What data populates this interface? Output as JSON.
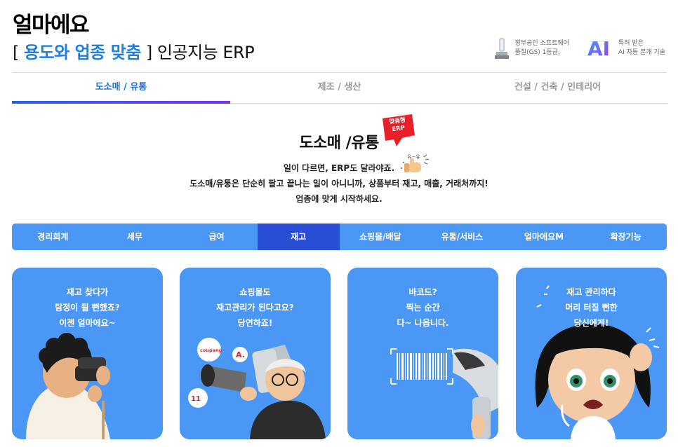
{
  "brand": {
    "logo": "얼마에요"
  },
  "tagline": {
    "open": "[ ",
    "highlight": "용도와 업종 맞춤",
    "close": " ] ",
    "rest": "인공지능 ERP"
  },
  "badges": [
    {
      "icon": "trophy-icon",
      "lines": [
        "정부공인 소프트웨어",
        "품질(GS) 1등급,"
      ]
    },
    {
      "mark": "AI",
      "lines": [
        "특허 받은",
        "AI 자동 분개 기술"
      ]
    }
  ],
  "tabs": [
    {
      "label": "도소매 / 유통",
      "active": true
    },
    {
      "label": "제조 / 생산",
      "active": false
    },
    {
      "label": "건설 / 건축 / 인테리어",
      "active": false
    }
  ],
  "section": {
    "title": "도소매 /유통",
    "ribbon": [
      "맞춤형",
      "ERP"
    ],
    "lines": [
      "일이 다르면, ERP도 달라야죠.",
      "도소매/유통은 단순히 팔고 끝나는 일이 아니니까, 상품부터 재고, 매출, 거래처까지!",
      "업종에 맞게 시작하세요."
    ]
  },
  "categories": [
    {
      "label": "경리회계",
      "active": false
    },
    {
      "label": "세무",
      "active": false
    },
    {
      "label": "급여",
      "active": false
    },
    {
      "label": "재고",
      "active": true
    },
    {
      "label": "쇼핑몰/배달",
      "active": false
    },
    {
      "label": "유통/서비스",
      "active": false
    },
    {
      "label": "얼마에요M",
      "active": false
    },
    {
      "label": "확장기능",
      "active": false
    }
  ],
  "cards": [
    {
      "lines": [
        "재고 찾다가",
        "탐정이 될 뻔했죠?",
        "이젠 얼마에요~"
      ],
      "illustration": "binoculars-person"
    },
    {
      "lines": [
        "쇼핑몰도",
        "재고관리가 된다고요?",
        "당연하죠!"
      ],
      "illustration": "megaphone-person",
      "app_badges": [
        "coupang",
        "A.",
        "11"
      ]
    },
    {
      "lines": [
        "바코드?",
        "찍는 순간",
        "다~ 나옵니다."
      ],
      "illustration": "barcode-scanner"
    },
    {
      "lines": [
        "재고 관리하다",
        "머리 터질 뻔한",
        "당신에게!"
      ],
      "illustration": "stressed-woman"
    }
  ],
  "colors": {
    "accent": "#1d7fe3",
    "bar": "#4a97f5",
    "active_bar": "#2a4dd6",
    "ribbon": "#e8202a"
  }
}
